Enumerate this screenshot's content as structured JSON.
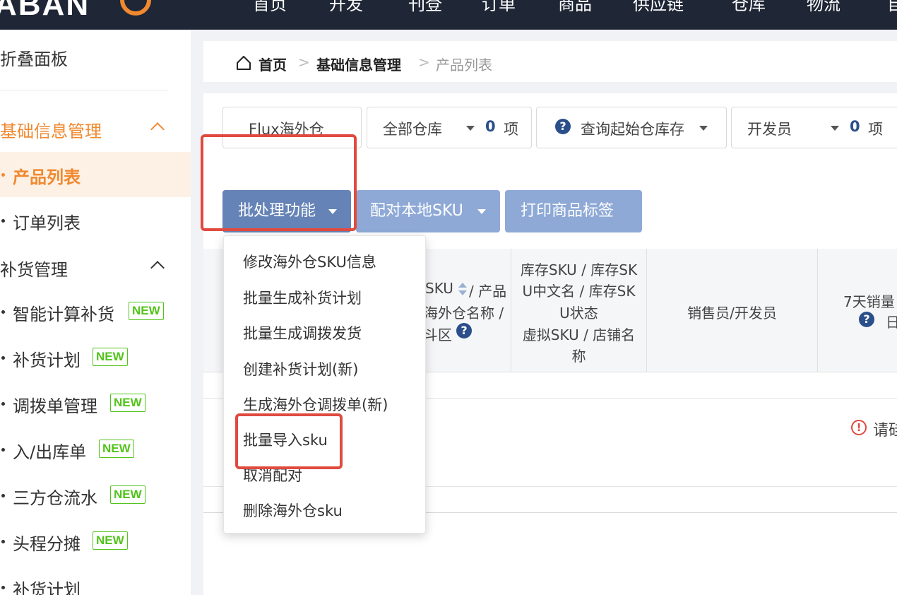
{
  "topbar": {
    "logo_text": "ABAN",
    "nav": [
      "首页",
      "开发",
      "刊登",
      "订单",
      "商品",
      "供应链",
      "仓库",
      "物流",
      "自"
    ]
  },
  "sidebar": {
    "header": "折叠面板",
    "groups": [
      {
        "label": "基础信息管理",
        "active": true
      },
      {
        "label": "补货管理",
        "active": false
      }
    ],
    "items": [
      {
        "label": "产品列表",
        "active": true,
        "new": false
      },
      {
        "label": "订单列表",
        "active": false,
        "new": false
      },
      {
        "label": "智能计算补货",
        "active": false,
        "new": true
      },
      {
        "label": "补货计划",
        "active": false,
        "new": true
      },
      {
        "label": "调拨单管理",
        "active": false,
        "new": true
      },
      {
        "label": "入/出库单",
        "active": false,
        "new": true
      },
      {
        "label": "三方仓流水",
        "active": false,
        "new": true
      },
      {
        "label": "头程分摊",
        "active": false,
        "new": true
      },
      {
        "label": "补货计划",
        "active": false,
        "new": false
      }
    ],
    "new_badge": "NEW"
  },
  "breadcrumb": {
    "home": "首页",
    "level1": "基础信息管理",
    "current": "产品列表",
    "sep": ">"
  },
  "filters": {
    "warehouse_type": "Flux海外仓",
    "all_warehouses": "全部仓库",
    "all_warehouses_count": "0",
    "unit": "项",
    "query_stock": "查询起始仓库存",
    "developer": "开发员",
    "developer_count": "0"
  },
  "actions": {
    "batch": "批处理功能",
    "pair_sku": "配对本地SKU",
    "print_label": "打印商品标签"
  },
  "table": {
    "col1_lines": [
      "SKU",
      "/ 产品",
      "海外仓名称 /",
      "斗区"
    ],
    "col2_lines": [
      "库存SKU / 库存SK",
      "U中文名 / 库存SK",
      "U状态",
      "虚拟SKU / 店铺名",
      "称"
    ],
    "col3": "销售员/开发员",
    "col4_lines": [
      "7天销量",
      "日"
    ],
    "empty_hint": "请硅"
  },
  "dropdown": {
    "items": [
      "修改海外仓SKU信息",
      "批量生成补货计划",
      "批量生成调拨发货",
      "创建补货计划(新)",
      "生成海外仓调拨单(新)",
      "批量导入sku",
      "取消配对",
      "删除海外仓sku"
    ]
  },
  "colors": {
    "topbar": "#1f2636",
    "accent_orange": "#f0892f",
    "primary_button": "#6583b6",
    "light_button": "#8ea9d6",
    "annotation_red": "#e04a3f",
    "new_green": "#52c41a"
  }
}
